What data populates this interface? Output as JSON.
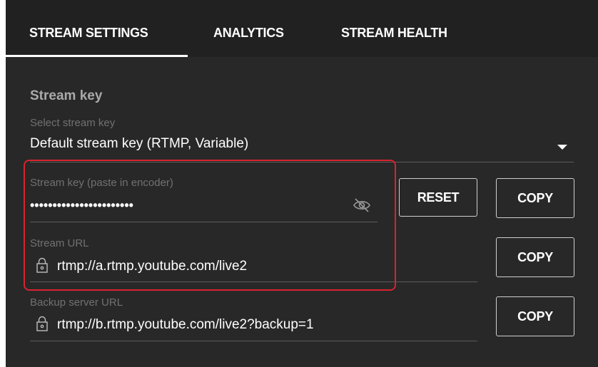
{
  "tabs": [
    {
      "label": "STREAM SETTINGS",
      "active": true
    },
    {
      "label": "ANALYTICS",
      "active": false
    },
    {
      "label": "STREAM HEALTH",
      "active": false
    }
  ],
  "stream_key_section": {
    "title": "Stream key",
    "select_label": "Select stream key",
    "selected_value": "Default stream key (RTMP, Variable)"
  },
  "stream_key_field": {
    "label": "Stream key (paste in encoder)",
    "masked_value": "•••••••••••••••••••••••",
    "visibility_icon": "eye-off-icon"
  },
  "stream_url_field": {
    "label": "Stream URL",
    "value": "rtmp://a.rtmp.youtube.com/live2",
    "icon": "lock-icon"
  },
  "backup_url_field": {
    "label": "Backup server URL",
    "value": "rtmp://b.rtmp.youtube.com/live2?backup=1",
    "icon": "lock-icon"
  },
  "buttons": {
    "reset_label": "RESET",
    "copy_label": "COPY"
  },
  "colors": {
    "panel_bg": "#282828",
    "tabbar_bg": "#212121",
    "highlight": "#d9232e",
    "label_gray": "#717171",
    "title_gray": "#aaaaaa"
  }
}
